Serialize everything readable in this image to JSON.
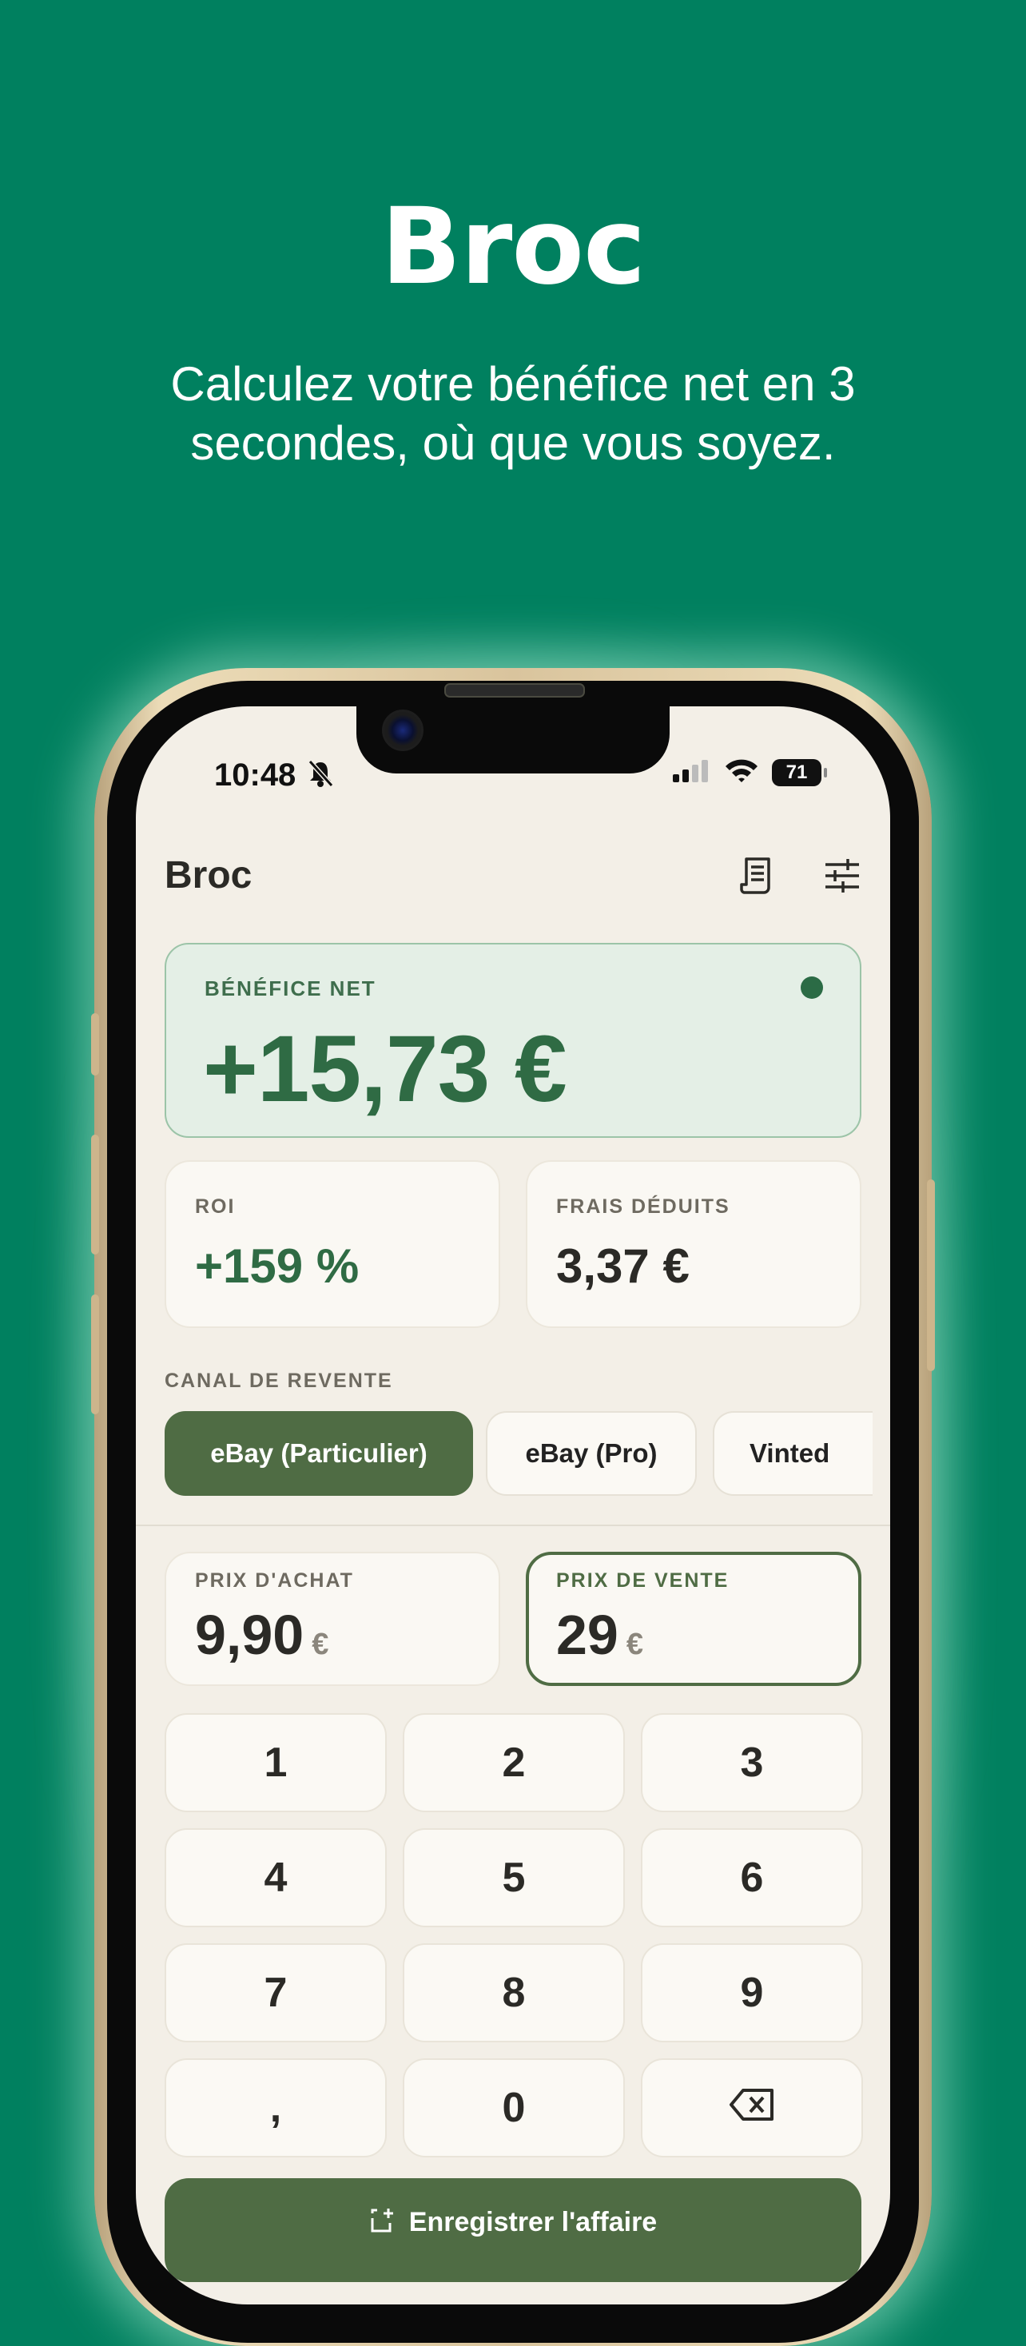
{
  "hero": {
    "title": "Broc",
    "subtitle": "Calculez votre bénéfice net en 3 secondes, où que vous soyez."
  },
  "status_bar": {
    "time": "10:48",
    "battery": "71"
  },
  "header": {
    "title": "Broc"
  },
  "net_profit": {
    "label": "BÉNÉFICE NET",
    "value": "+15,73 €"
  },
  "stats": [
    {
      "label": "ROI",
      "value": "+159 %",
      "color": "#2f6b44"
    },
    {
      "label": "FRAIS DÉDUITS",
      "value": "3,37 €",
      "color": "#2b2a26"
    }
  ],
  "channel": {
    "label": "CANAL DE REVENTE",
    "options": [
      "eBay (Particulier)",
      "eBay (Pro)",
      "Vinted"
    ],
    "selected": "eBay (Particulier)"
  },
  "purchase": {
    "label": "PRIX D'ACHAT",
    "value": "9,90",
    "currency": "€"
  },
  "sale": {
    "label": "PRIX DE VENTE",
    "value": "29",
    "currency": "€"
  },
  "keypad": [
    "1",
    "2",
    "3",
    "4",
    "5",
    "6",
    "7",
    "8",
    "9",
    ",",
    "0",
    "backspace-icon"
  ],
  "save_button": {
    "label": "Enregistrer l'affaire"
  },
  "colors": {
    "background": "#00805f",
    "accent": "#4f6c44",
    "profit": "#2f6b44"
  }
}
